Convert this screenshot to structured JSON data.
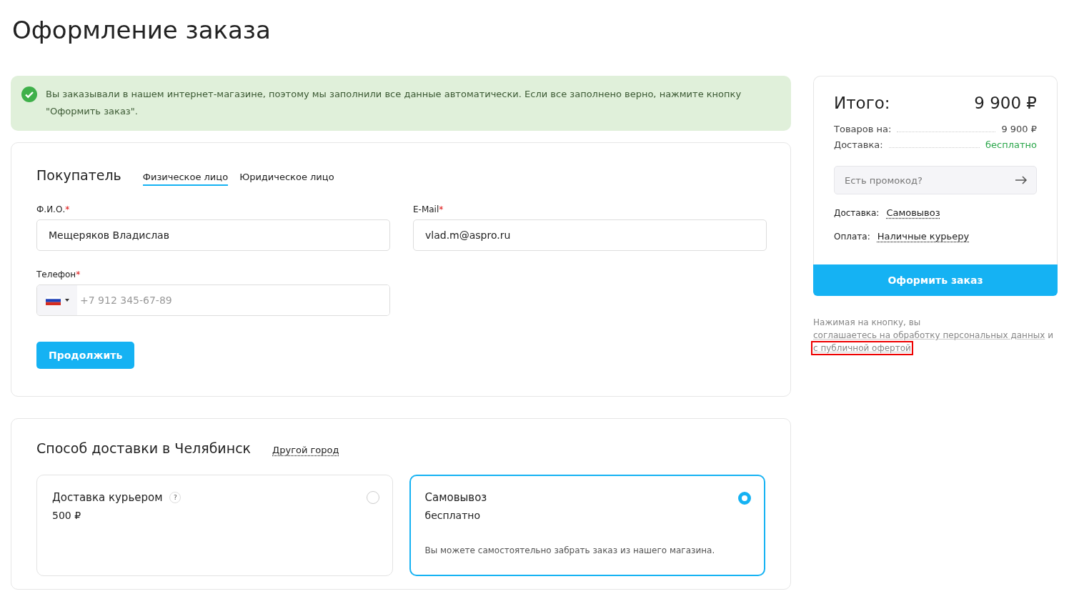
{
  "page_title": "Оформление заказа",
  "notice": {
    "text": "Вы заказывали в нашем интернет-магазине, поэтому мы заполнили все данные автоматически. Если все заполнено верно, нажмите кнопку \"Оформить заказ\"."
  },
  "buyer": {
    "title": "Покупатель",
    "tabs": [
      {
        "label": "Физическое лицо",
        "selected": true
      },
      {
        "label": "Юридическое лицо",
        "selected": false
      }
    ],
    "fields": [
      {
        "label": "Ф.И.О.",
        "required_mark": "*",
        "value": "Мещеряков Владислав",
        "kind": "text"
      },
      {
        "label": "E-Mail",
        "required_mark": "*",
        "value": "vlad.m@aspro.ru",
        "kind": "text"
      },
      {
        "label": "Телефон",
        "required_mark": "*",
        "placeholder": "+7 912 345-67-89",
        "kind": "phone"
      }
    ],
    "button": "Продолжить"
  },
  "delivery": {
    "title": "Способ доставки в Челябинск",
    "city_link": "Другой город",
    "options": [
      {
        "name": "Доставка курьером",
        "help": "?",
        "price": "500 ₽",
        "selected": false
      },
      {
        "name": "Самовывоз",
        "price": "бесплатно",
        "description": "Вы можете самостоятельно забрать заказ из нашего магазина.",
        "selected": true
      }
    ]
  },
  "summary": {
    "title": "Итого:",
    "total": "9 900 ₽",
    "rows": [
      {
        "label": "Товаров на:",
        "value": "9 900 ₽",
        "kind": "price"
      },
      {
        "label": "Доставка:",
        "value": "бесплатно",
        "kind": "free"
      }
    ],
    "promo_placeholder": "Есть промокод?",
    "choices": [
      {
        "label": "Доставка:",
        "value": "Самовывоз"
      },
      {
        "label": "Оплата:",
        "value": "Наличные курьеру"
      }
    ],
    "button": "Оформить заказ",
    "consent": [
      {
        "kind": "text",
        "text": "Нажимая на кнопку, вы "
      },
      {
        "kind": "link",
        "text": "соглашаетесь на обработку персональных данных"
      },
      {
        "kind": "text",
        "text": " и "
      },
      {
        "kind": "link",
        "text": "с публичной офертой",
        "highlighted": true
      }
    ]
  }
}
